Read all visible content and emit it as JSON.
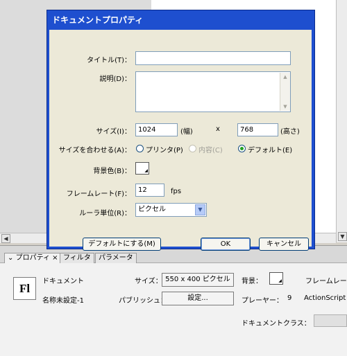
{
  "dialog": {
    "title": "ドキュメントプロパティ",
    "labels": {
      "title": "タイトル(T)：",
      "description": "説明(D)：",
      "size": "サイズ(I)：",
      "match": "サイズを合わせる(A)：",
      "bg_color": "背景色(B)：",
      "frame_rate": "フレームレート(F)：",
      "ruler_units": "ルーラ単位(R)："
    },
    "title_value": "",
    "description_value": "",
    "width": "1024",
    "width_unit": "(幅)",
    "times": "x",
    "height": "768",
    "height_unit": "(高さ)",
    "match_options": [
      "プリンタ(P)",
      "内容(C)",
      "デフォルト(E)"
    ],
    "match_selected": "デフォルト(E)",
    "frame_rate_value": "12",
    "fps_label": "fps",
    "ruler_units_value": "ピクセル",
    "buttons": {
      "make_default": "デフォルトにする(M)",
      "ok": "OK",
      "cancel": "キャンセル"
    }
  },
  "panel": {
    "tabs": [
      {
        "icon": "⌄",
        "label": "プロパティ",
        "close": "×"
      },
      {
        "label": "フィルタ"
      },
      {
        "label": "パラメータ"
      }
    ],
    "logo": "Fl",
    "doc_label": "ドキュメント",
    "doc_name": "名称未設定-1",
    "size_label": "サイズ：",
    "size_value": "550 x 400 ピクセル",
    "bg_label": "背景：",
    "frame_rate_label": "フレームレー",
    "publish_label": "パブリッシュ：",
    "settings_button": "設定...",
    "player_label": "プレーヤー：",
    "player_version": "9",
    "actionscript_label": "ActionScript",
    "doc_class_label": "ドキュメントクラス："
  },
  "colors": {
    "dialog_title_bar": "#1e4fcf",
    "dialog_client": "#ece9d8",
    "swatch": "#ffffff"
  }
}
